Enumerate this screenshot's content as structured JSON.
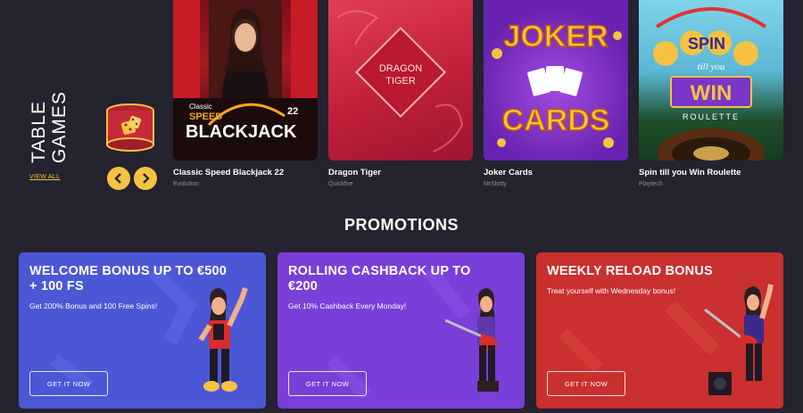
{
  "table_games": {
    "title_line1": "TABLE",
    "title_line2": "GAMES",
    "view_all": "VIEW ALL"
  },
  "games": [
    {
      "name": "Classic Speed Blackjack 22",
      "provider": "Evolution",
      "art_line1": "Classic",
      "art_line2": "SPEED",
      "art_line3": "BLACKJACK",
      "art_number": "22"
    },
    {
      "name": "Dragon Tiger",
      "provider": "Quickfire",
      "art_line1": "DRAGON",
      "art_line2": "TIGER"
    },
    {
      "name": "Joker Cards",
      "provider": "MrSlotty",
      "art_line1": "JOKER",
      "art_line2": "CARDS"
    },
    {
      "name": "Spin till you Win Roulette",
      "provider": "Playtech",
      "art_line1": "SPIN",
      "art_line2": "till you",
      "art_line3": "WIN",
      "art_line4": "ROULETTE"
    }
  ],
  "promotions": {
    "heading": "PROMOTIONS",
    "cards": [
      {
        "title": "WELCOME BONUS UP TO €500 + 100 FS",
        "text": "Get 200% Bonus and 100 Free Spins!",
        "button": "GET IT NOW",
        "color": "#4c57d6"
      },
      {
        "title": "ROLLING CASHBACK UP TO €200",
        "text": "Get 10% Cashback Every Monday!",
        "button": "GET IT NOW",
        "color": "#7a3fd8"
      },
      {
        "title": "WEEKLY RELOAD BONUS",
        "text": "Treat yourself with Wednesday bonus!",
        "button": "GET IT NOW",
        "color": "#c9302f"
      }
    ]
  },
  "colors": {
    "background": "#24232f",
    "accent": "#f5c242"
  }
}
